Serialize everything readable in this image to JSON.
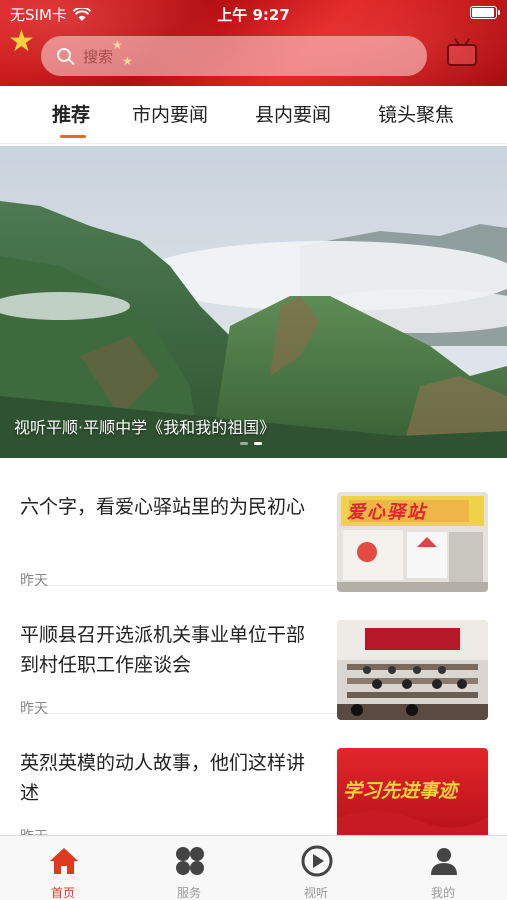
{
  "status_bar": {
    "carrier": "无SIM卡",
    "time": "上午 9:27"
  },
  "search": {
    "placeholder": "搜索"
  },
  "tabs": [
    {
      "label": "推荐",
      "active": true
    },
    {
      "label": "市内要闻",
      "active": false
    },
    {
      "label": "县内要闻",
      "active": false
    },
    {
      "label": "镜头聚焦",
      "active": false
    }
  ],
  "banner": {
    "caption": "视听平顺·平顺中学《我和我的祖国》"
  },
  "news": [
    {
      "title": "六个字，看爱心驿站里的为民初心",
      "time": "昨天",
      "thumb_text": "爱心驿站"
    },
    {
      "title": "平顺县召开选派机关事业单位干部到村任职工作座谈会",
      "time": "昨天"
    },
    {
      "title": "英烈英模的动人故事，他们这样讲述",
      "time": "昨天",
      "thumb_text": "学习先进事迹"
    }
  ],
  "bottom_nav": [
    {
      "label": "首页",
      "icon": "home-icon",
      "active": true
    },
    {
      "label": "服务",
      "icon": "grid-icon",
      "active": false
    },
    {
      "label": "视听",
      "icon": "play-icon",
      "active": false
    },
    {
      "label": "我的",
      "icon": "user-icon",
      "active": false
    }
  ],
  "colors": {
    "brand_red": "#d81e1e",
    "accent_orange": "#e96a1a",
    "active_nav": "#e03a1e"
  }
}
